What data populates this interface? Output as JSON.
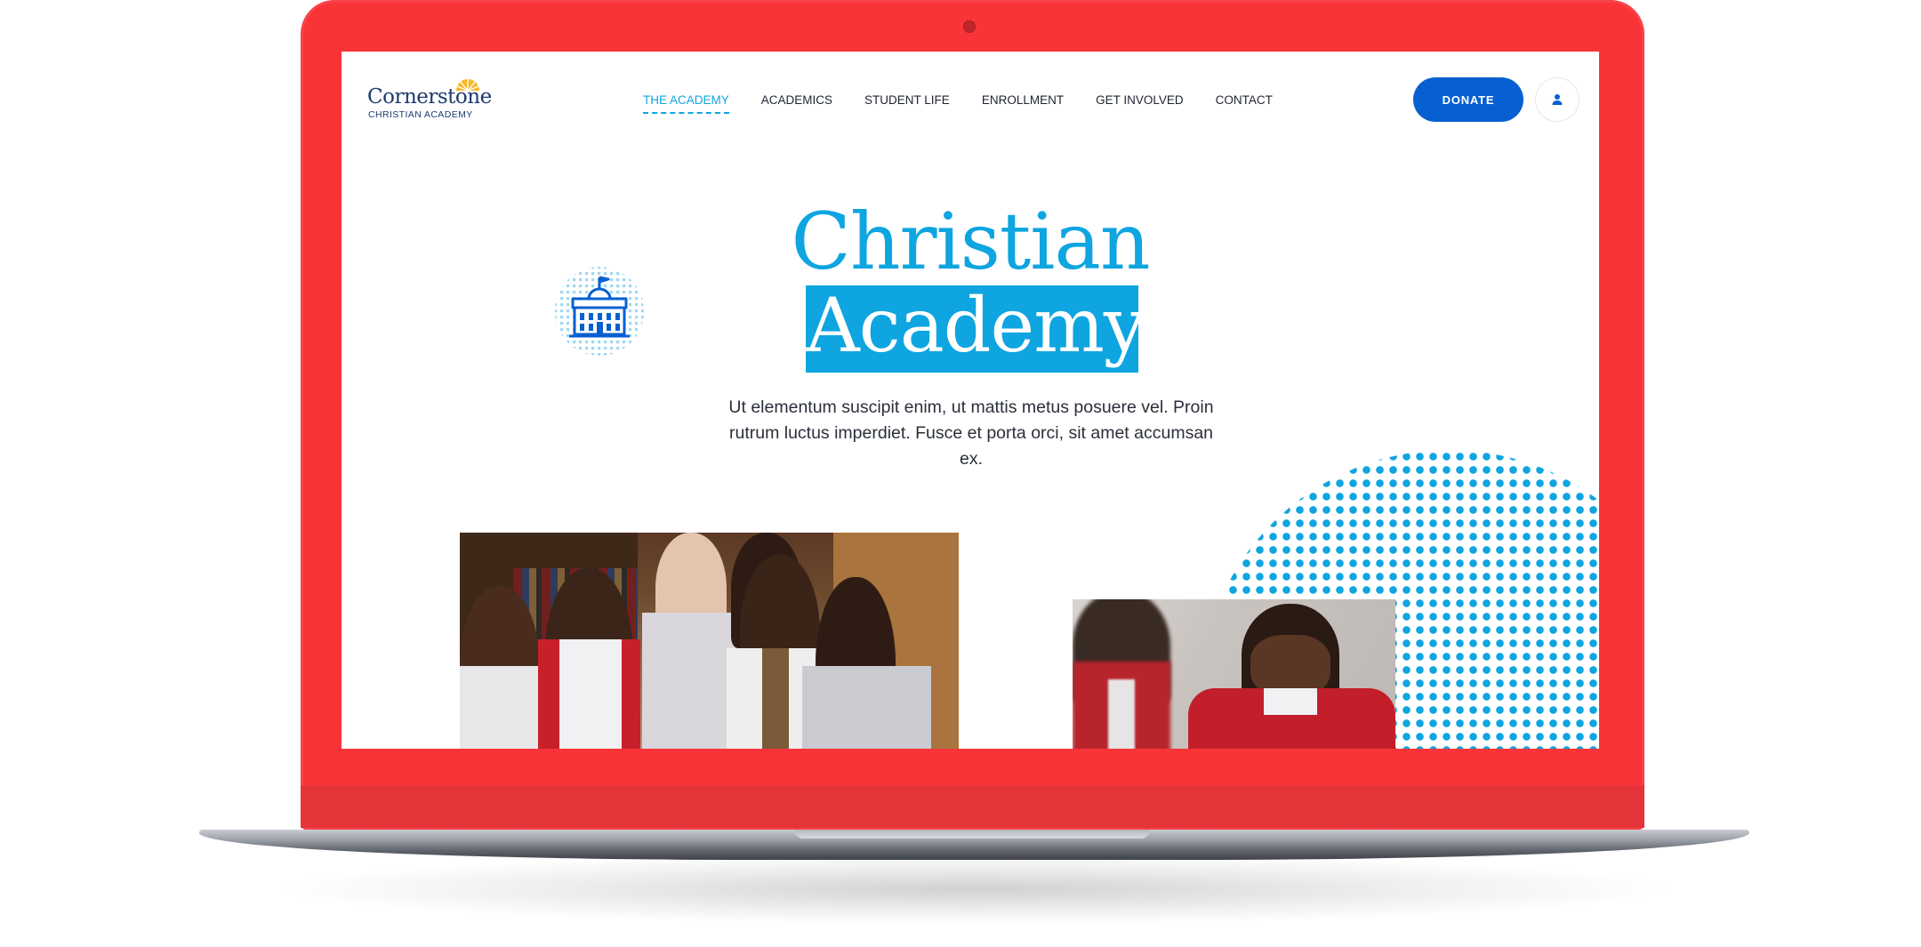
{
  "brand": {
    "name": "Cornerstone",
    "tagline": "CHRISTIAN ACADEMY"
  },
  "nav": {
    "items": [
      {
        "label": "THE ACADEMY",
        "active": true
      },
      {
        "label": "ACADEMICS",
        "active": false
      },
      {
        "label": "STUDENT LIFE",
        "active": false
      },
      {
        "label": "ENROLLMENT",
        "active": false
      },
      {
        "label": "GET INVOLVED",
        "active": false
      },
      {
        "label": "CONTACT",
        "active": false
      }
    ],
    "donate_label": "DONATE",
    "account_icon": "user-icon"
  },
  "hero": {
    "title_line1": "Christian",
    "title_line2": "Academy",
    "description": "Ut elementum suscipit enim, ut mattis metus posuere vel. Proin rutrum luctus imperdiet. Fusce et porta orci, sit amet accumsan ex.",
    "icon": "school-building-icon"
  },
  "colors": {
    "accent": "#0ea5e0",
    "primary_button": "#0760d1",
    "laptop_frame": "#f83439",
    "brand_navy": "#1d3a6e"
  }
}
